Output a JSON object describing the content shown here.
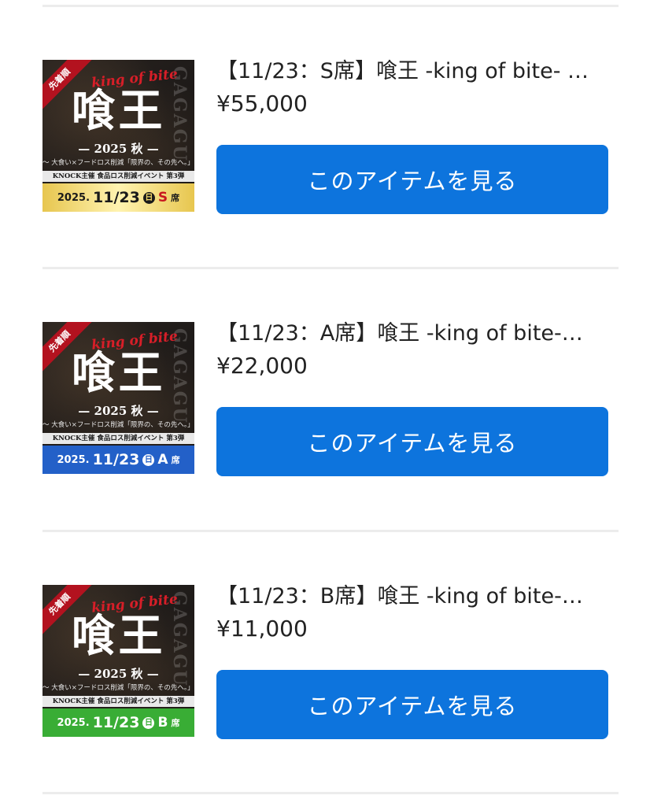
{
  "items": [
    {
      "title": "【11/23：S席】喰王 -king of bite- …",
      "price": "¥55,000",
      "button_label": "このアイテムを見る",
      "thumb": {
        "ribbon": "先着順",
        "script": "king of bite",
        "heading": "喰王",
        "year": "— 2025 秋 —",
        "subtitle": "〜 大食い×フードロス削減「限界の、その先へ。」〜",
        "band": "KNOCK主催 食品ロス削減イベント 第3弾",
        "side_text": "GAGAGU",
        "date_year": "2025.",
        "date_day": "11/23",
        "date_weekday": "日",
        "seat": "S",
        "seat_suffix": "席"
      }
    },
    {
      "title": "【11/23：A席】喰王 -king of bite-…",
      "price": "¥22,000",
      "button_label": "このアイテムを見る",
      "thumb": {
        "ribbon": "先着順",
        "script": "king of bite",
        "heading": "喰王",
        "year": "— 2025 秋 —",
        "subtitle": "〜 大食い×フードロス削減「限界の、その先へ。」〜",
        "band": "KNOCK主催 食品ロス削減イベント 第3弾",
        "side_text": "GAGAGU",
        "date_year": "2025.",
        "date_day": "11/23",
        "date_weekday": "日",
        "seat": "A",
        "seat_suffix": "席"
      }
    },
    {
      "title": "【11/23：B席】喰王 -king of bite-…",
      "price": "¥11,000",
      "button_label": "このアイテムを見る",
      "thumb": {
        "ribbon": "先着順",
        "script": "king of bite",
        "heading": "喰王",
        "year": "— 2025 秋 —",
        "subtitle": "〜 大食い×フードロス削減「限界の、その先へ。」〜",
        "band": "KNOCK主催 食品ロス削減イベント 第3弾",
        "side_text": "GAGAGU",
        "date_year": "2025.",
        "date_day": "11/23",
        "date_weekday": "日",
        "seat": "B",
        "seat_suffix": "席"
      }
    }
  ],
  "colors": {
    "button": "#0d74dd",
    "divider": "#ececec",
    "text": "#222222",
    "seat_s_band": "#e7c64f",
    "seat_a_band": "#2360c8",
    "seat_b_band": "#39ad35"
  }
}
